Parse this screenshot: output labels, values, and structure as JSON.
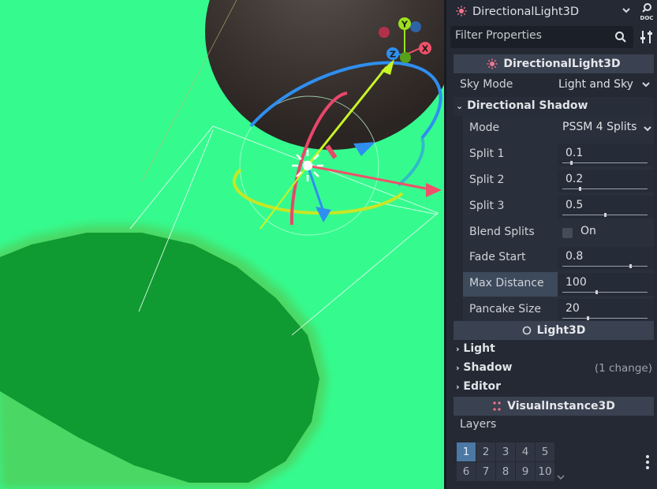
{
  "inspector": {
    "node_name": "DirectionalLight3D",
    "doc_label": "DOC",
    "filter_placeholder": "Filter Properties",
    "sections": {
      "directional": "DirectionalLight3D",
      "light3d": "Light3D",
      "visual": "VisualInstance3D"
    },
    "sky_mode": {
      "label": "Sky Mode",
      "value": "Light and Sky"
    },
    "directional_shadow": {
      "label": "Directional Shadow",
      "mode": {
        "label": "Mode",
        "value": "PSSM 4 Splits"
      },
      "split1": {
        "label": "Split 1",
        "value": "0.1",
        "level": 0.1
      },
      "split2": {
        "label": "Split 2",
        "value": "0.2",
        "level": 0.2
      },
      "split3": {
        "label": "Split 3",
        "value": "0.5",
        "level": 0.5
      },
      "blend_splits": {
        "label": "Blend Splits",
        "value": "On"
      },
      "fade_start": {
        "label": "Fade Start",
        "value": "0.8",
        "level": 0.8
      },
      "max_distance": {
        "label": "Max Distance",
        "value": "100",
        "level": 0.4
      },
      "pancake_size": {
        "label": "Pancake Size",
        "value": "20",
        "level": 0.3
      }
    },
    "light": "Light",
    "shadow": "Shadow",
    "shadow_note": "(1 change)",
    "editor": "Editor",
    "layers_label": "Layers",
    "layers": [
      "1",
      "2",
      "3",
      "4",
      "5",
      "6",
      "7",
      "8",
      "9",
      "10"
    ],
    "active_layer": "1"
  },
  "gizmo": {
    "x": "X",
    "y": "Y",
    "z": "Z"
  },
  "colors": {
    "ground": "#35fb8f",
    "shadow": "#0f9a32",
    "sphere": "#3b3431",
    "accent": "#4b78a4",
    "axis_x": "#f0506a",
    "axis_y": "#9be21a",
    "axis_z": "#2f8ff0"
  }
}
